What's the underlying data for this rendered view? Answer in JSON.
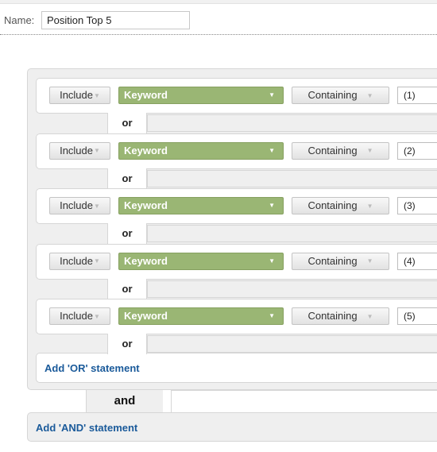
{
  "name_label": "Name:",
  "name_value": "Position Top 5",
  "rows": [
    {
      "include": "Include",
      "dimension": "Keyword",
      "match": "Containing",
      "value": "(1)",
      "connector": "or"
    },
    {
      "include": "Include",
      "dimension": "Keyword",
      "match": "Containing",
      "value": "(2)",
      "connector": "or"
    },
    {
      "include": "Include",
      "dimension": "Keyword",
      "match": "Containing",
      "value": "(3)",
      "connector": "or"
    },
    {
      "include": "Include",
      "dimension": "Keyword",
      "match": "Containing",
      "value": "(4)",
      "connector": "or"
    },
    {
      "include": "Include",
      "dimension": "Keyword",
      "match": "Containing",
      "value": "(5)",
      "connector": "or"
    }
  ],
  "add_or": "Add 'OR' statement",
  "and_label": "and",
  "add_and": "Add 'AND' statement",
  "colors": {
    "keyword_green": "#9ab674",
    "link_blue": "#1a5a9a",
    "panel_gray": "#efefef"
  }
}
